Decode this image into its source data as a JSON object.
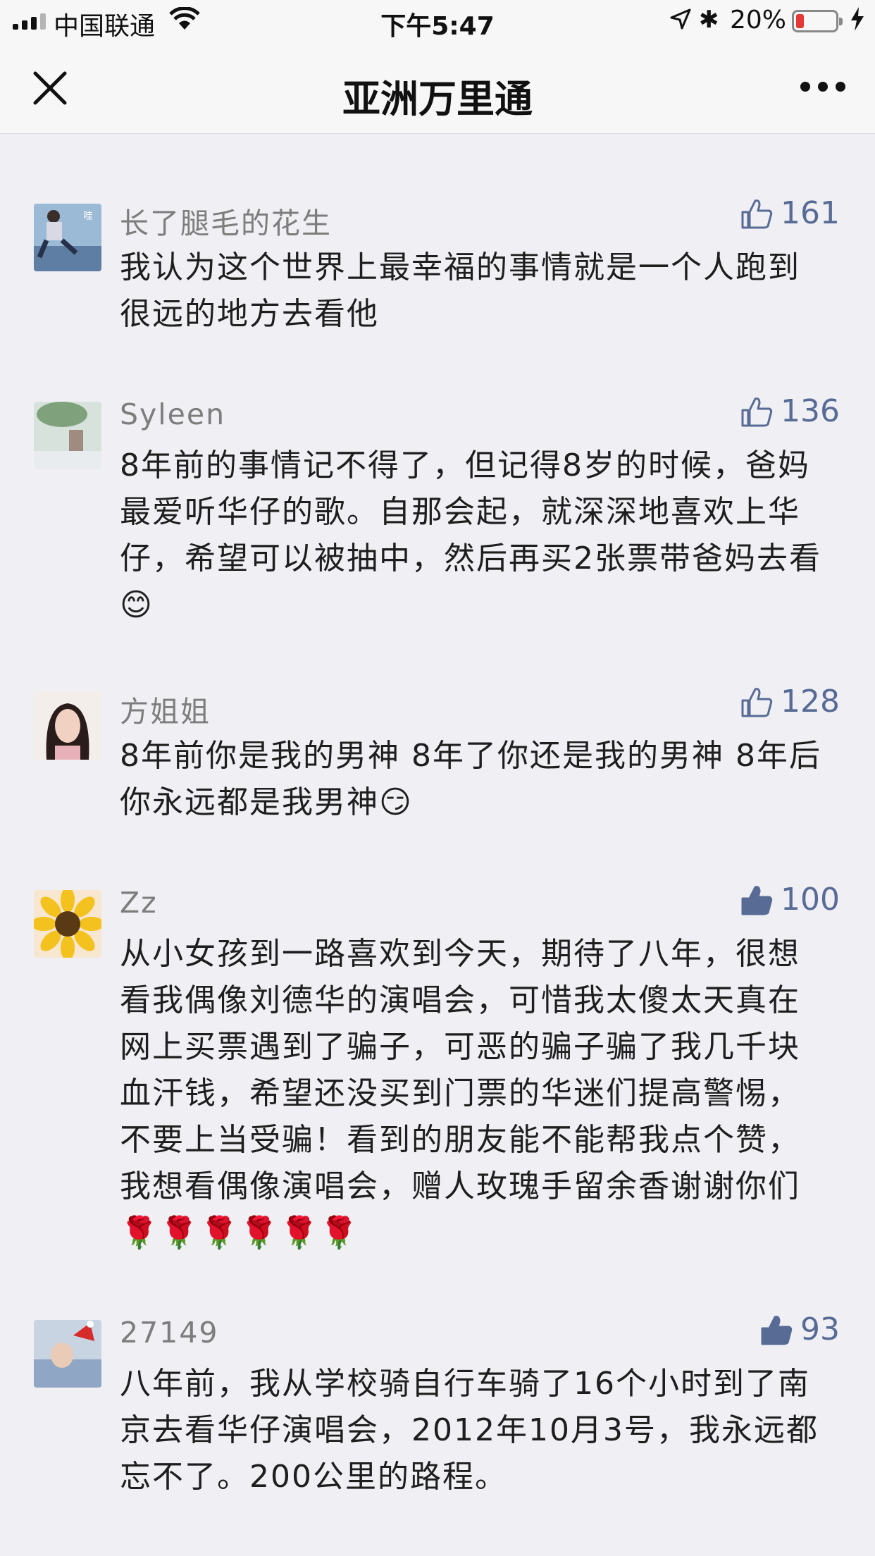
{
  "status_bar": {
    "carrier": "中国联通",
    "time": "下午5:47",
    "battery": "20%",
    "battery_level": 0.2
  },
  "nav": {
    "title": "亚洲万里通"
  },
  "comments": [
    {
      "author": "长了腿毛的花生",
      "likes": "161",
      "liked": false,
      "text": "我认为这个世界上最幸福的事情就是一个人跑到很远的地方去看他",
      "avatar_color": "#7fa6c7",
      "avatar_label": "哇"
    },
    {
      "author": "Syleen",
      "likes": "136",
      "liked": false,
      "text": "8年前的事情记不得了，但记得8岁的时候，爸妈最爱听华仔的歌。自那会起，就深深地喜欢上华仔，希望可以被抽中，然后再买2张票带爸妈去看😊",
      "avatar_color": "#c9d8c2"
    },
    {
      "author": "方姐姐",
      "likes": "128",
      "liked": false,
      "text": "8年前你是我的男神 8年了你还是我的男神 8年后你永远都是我男神😏",
      "avatar_color": "#f2ece6"
    },
    {
      "author": "Zz",
      "likes": "100",
      "liked": true,
      "text": "从小女孩到一路喜欢到今天，期待了八年，很想看我偶像刘德华的演唱会，可惜我太傻太天真在网上买票遇到了骗子，可恶的骗子骗了我几千块血汗钱，希望还没买到门票的华迷们提高警惕，不要上当受骗！看到的朋友能不能帮我点个赞，我想看偶像演唱会，赠人玫瑰手留余香谢谢你们🌹🌹🌹🌹🌹🌹",
      "avatar_color": "#f4c21f"
    },
    {
      "author": "27149",
      "likes": "93",
      "liked": true,
      "text": "八年前，我从学校骑自行车骑了16个小时到了南京去看华仔演唱会，2012年10月3号，我永远都忘不了。200公里的路程。",
      "avatar_color": "#8fa7c4"
    }
  ],
  "colors": {
    "accent": "#576b95",
    "background": "#efeff4"
  }
}
